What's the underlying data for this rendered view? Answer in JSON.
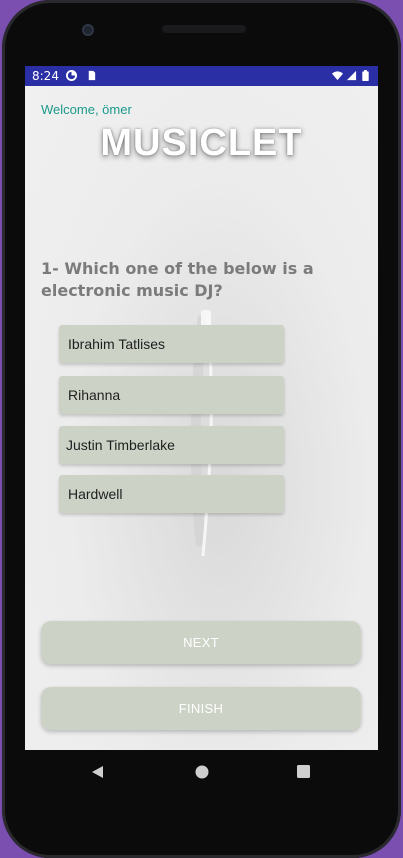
{
  "status_bar": {
    "time": "8:24"
  },
  "app": {
    "welcome_text": "Welcome, ömer",
    "title": "MUSICLET"
  },
  "quiz": {
    "question": "1- Which one of the below is a electronic music DJ?",
    "options": [
      {
        "label": "Ibrahim Tatlises"
      },
      {
        "label": "Rihanna"
      },
      {
        "label": "Justin Timberlake"
      },
      {
        "label": "Hardwell"
      }
    ]
  },
  "actions": {
    "next_label": "NEXT",
    "finish_label": "FINISH"
  },
  "colors": {
    "status_bar_bg": "#2b2fa5",
    "welcome_text": "#1a9a8a",
    "button_bg": "#ccd3c6",
    "question_text": "#7b7b7b",
    "device_frame": "#0b0b0c",
    "background": "#7a4fb0"
  },
  "icons": {
    "status_left": [
      "data-saver-icon",
      "sim-card-icon"
    ],
    "status_right": [
      "wifi-icon",
      "cell-signal-icon",
      "battery-icon"
    ],
    "nav": [
      "back-icon",
      "home-icon",
      "overview-icon"
    ]
  }
}
